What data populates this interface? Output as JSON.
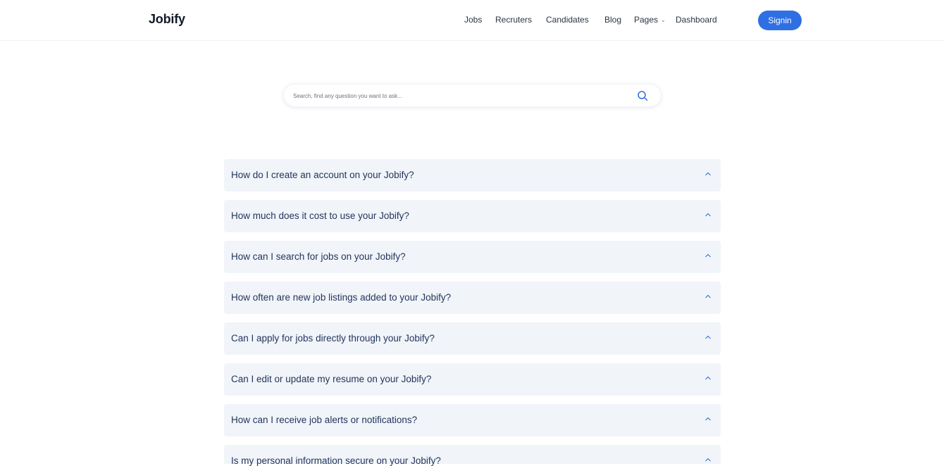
{
  "brand": {
    "name": "Jobify",
    "accent": "#2f6fe4"
  },
  "nav": {
    "items": [
      {
        "label": "Jobs"
      },
      {
        "label": "Recruters"
      },
      {
        "label": "Candidates"
      },
      {
        "label": "Blog"
      },
      {
        "label": "Pages",
        "has_dropdown": true
      },
      {
        "label": "Dashboard"
      }
    ],
    "signin_label": "Signin"
  },
  "search": {
    "placeholder": "Search, find any question you want to ask...",
    "value": "",
    "icon": "search-icon"
  },
  "faq": {
    "expand_icon": "chevron-up-icon",
    "questions": [
      "How do I create an account on your Jobify?",
      "How much does it cost to use your Jobify?",
      "How can I search for jobs on your Jobify?",
      "How often are new job listings added to your Jobify?",
      "Can I apply for jobs directly through your Jobify?",
      "Can I edit or update my resume on your Jobify?",
      "How can I receive job alerts or notifications?",
      "Is my personal information secure on your Jobify?"
    ]
  }
}
